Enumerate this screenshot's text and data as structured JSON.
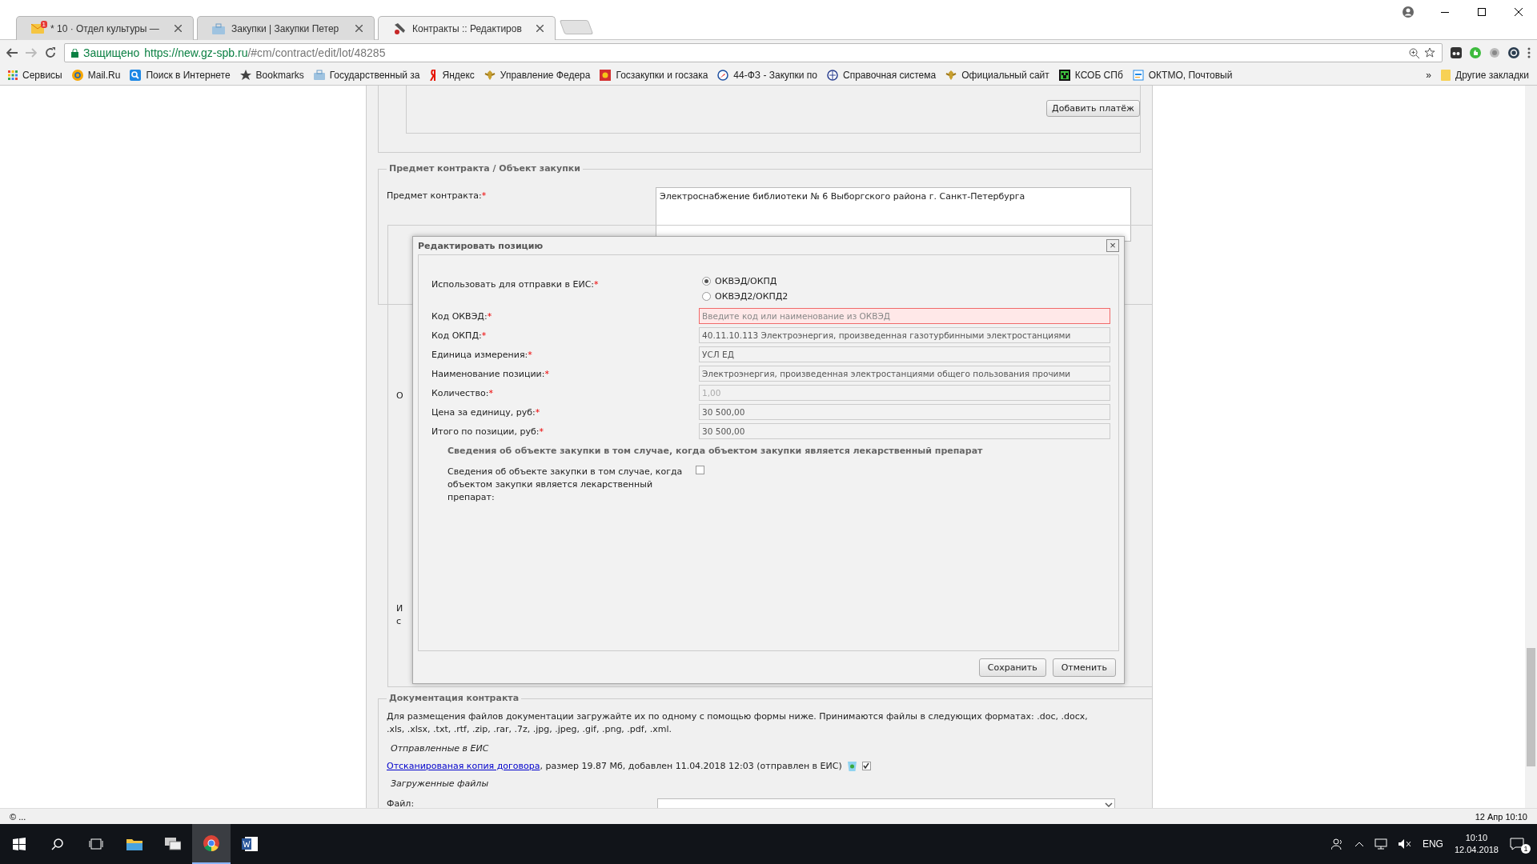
{
  "browser": {
    "tabs": [
      {
        "kind": "mail",
        "title": "* 10 · Отдел культуры —",
        "badge": "1",
        "selected": false
      },
      {
        "kind": "briefcase",
        "title": "Закупки | Закупки Петер",
        "selected": false
      },
      {
        "kind": "tools",
        "title": "Контракты :: Редактиров",
        "selected": true
      }
    ],
    "address": {
      "security": "Защищено",
      "host": "https://new.gz-spb.ru",
      "path": "/#cm/contract/edit/lot/48285"
    },
    "bookmarks": [
      {
        "kind": "apps",
        "label": "Сервисы"
      },
      {
        "kind": "at",
        "label": "Mail.Ru"
      },
      {
        "kind": "search",
        "label": "Поиск в Интернете"
      },
      {
        "kind": "star",
        "label": "Bookmarks"
      },
      {
        "kind": "briefcase",
        "label": "Государственный за"
      },
      {
        "kind": "yandex",
        "label": "Яндекс"
      },
      {
        "kind": "emblem",
        "label": "Управление Федера"
      },
      {
        "kind": "flag",
        "label": "Госзакупки и госзака"
      },
      {
        "kind": "compass",
        "label": "44-ФЗ - Закупки по"
      },
      {
        "kind": "globe",
        "label": "Справочная система"
      },
      {
        "kind": "emblem",
        "label": "Официальный сайт"
      },
      {
        "kind": "creeper",
        "label": "КСОБ СПб"
      },
      {
        "kind": "kod",
        "label": "ОКТМО, Почтовый"
      }
    ],
    "overflow": "»",
    "other_bookmarks": "Другие закладки"
  },
  "page": {
    "payments": {
      "button": "Добавить платёж"
    },
    "subject": {
      "legend": "Предмет контракта / Объект закупки",
      "label": "Предмет контракта:",
      "required_mark": "*",
      "value": "Электроснабжение библиотеки № 6 Выборгского района г. Санкт-Петербурга"
    },
    "positions": {
      "legend": "О",
      "note_lines": [
        "И",
        "с"
      ]
    },
    "documents": {
      "legend": "Документация контракта",
      "intro": "Для размещения файлов документации загружайте их по одному с помощью формы ниже. Принимаются файлы в следующих форматах: .doc, .docx, .xls, .xlsx, .txt, .rtf, .zip, .rar, .7z, .jpg, .jpeg, .gif, .png, .pdf, .xml.",
      "sent_heading": "Отправленные в ЕИС",
      "file": {
        "link": "Отсканированая копия договора",
        "details": ", размер 19.87 Мб, добавлен 11.04.2018 12:03 (отправлен в ЕИС)",
        "checked": true
      },
      "uploaded_heading": "Загруженные файлы",
      "file_label": "Файл:"
    }
  },
  "dialog": {
    "title": "Редактировать позицию",
    "close": "×",
    "rows": [
      {
        "kind": "radio",
        "label": "Использовать для отправки в ЕИС:",
        "required_mark": "*",
        "options": [
          {
            "label": "ОКВЭД/ОКПД",
            "selected": true
          },
          {
            "label": "ОКВЭД2/ОКПД2",
            "selected": false
          }
        ]
      },
      {
        "kind": "input",
        "label": "Код ОКВЭД:",
        "required_mark": "*",
        "placeholder": "Введите код или наименование из ОКВЭД",
        "invalid": true,
        "disabled": false
      },
      {
        "kind": "input",
        "label": "Код ОКПД:",
        "required_mark": "*",
        "value": "40.11.10.113 Электроэнергия, произведенная газотурбинными электростанциями",
        "invalid": false,
        "disabled": false
      },
      {
        "kind": "input",
        "label": "Единица измерения:",
        "required_mark": "*",
        "value": "УСЛ ЕД",
        "invalid": false,
        "disabled": false
      },
      {
        "kind": "input",
        "label": "Наименование позиции:",
        "required_mark": "*",
        "value": "Электроэнергия, произведенная электростанциями общего пользования прочими",
        "invalid": false,
        "disabled": false
      },
      {
        "kind": "input",
        "label": "Количество:",
        "required_mark": "*",
        "value": "1,00",
        "invalid": false,
        "disabled": true
      },
      {
        "kind": "input",
        "label": "Цена за единицу, руб:",
        "required_mark": "*",
        "value": "30 500,00",
        "invalid": false,
        "disabled": false
      },
      {
        "kind": "input",
        "label": "Итого по позиции, руб:",
        "required_mark": "*",
        "value": "30 500,00",
        "invalid": false,
        "disabled": false
      }
    ],
    "drug_section": {
      "heading": "Сведения об объекте закупки в том случае, когда объектом закупки является лекарственный препарат",
      "label": "Сведения об объекте закупки в том случае, когда объектом закупки является лекарственный препарат:",
      "checked": false
    },
    "buttons": [
      "Сохранить",
      "Отменить"
    ]
  },
  "status_bar": {
    "left": "© ...",
    "right": "12 Апр 10:10"
  },
  "taskbar": {
    "apps": [
      {
        "kind": "start",
        "selected": false
      },
      {
        "kind": "search",
        "selected": false
      },
      {
        "kind": "taskview",
        "selected": false
      },
      {
        "kind": "explorer",
        "selected": false
      },
      {
        "kind": "remote",
        "selected": false
      },
      {
        "kind": "chrome",
        "selected": true
      },
      {
        "kind": "word",
        "selected": false
      }
    ],
    "language": "ENG",
    "time": "10:10",
    "date": "12.04.2018",
    "notification_count": "1"
  }
}
